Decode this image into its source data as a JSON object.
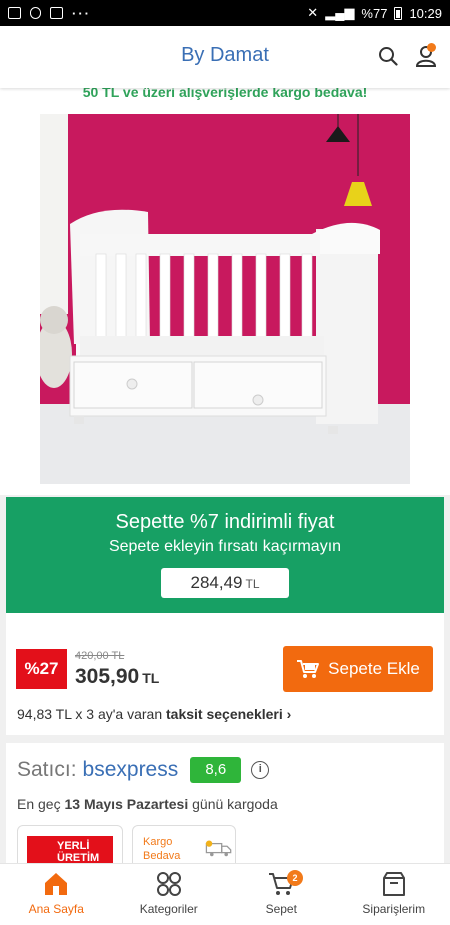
{
  "status_bar": {
    "battery": "%77",
    "time": "10:29"
  },
  "header": {
    "brand": "By Damat"
  },
  "shipping_banner": "50 TL ve üzeri alışverişlerde kargo bedava!",
  "discount": {
    "title": "Sepette %7 indirimli fiyat",
    "subtitle": "Sepete ekleyin fırsatı kaçırmayın",
    "price": "284,49",
    "currency": "TL"
  },
  "price": {
    "discount_badge": "%27",
    "old_price": "420,00 TL",
    "new_price": "305,90",
    "currency": "TL",
    "add_to_cart": "Sepete Ekle",
    "installment_prefix": "94,83 TL x 3 ay'a varan ",
    "installment_link": "taksit seçenekleri",
    "installment_chevron": "›"
  },
  "seller": {
    "label": "Satıcı:",
    "name": "bsexpress",
    "score": "8,6",
    "info": "i",
    "ship_prefix": "En geç ",
    "ship_date": "13 Mayıs Pazartesi",
    "ship_suffix": " günü kargoda",
    "badge_local_line1": "YERLİ",
    "badge_local_line2": "ÜRETİM",
    "badge_cargo_line1": "Kargo",
    "badge_cargo_line2": "Bedava"
  },
  "nav": {
    "items": [
      {
        "label": "Ana Sayfa",
        "icon": "home-icon",
        "active": true
      },
      {
        "label": "Kategoriler",
        "icon": "categories-icon"
      },
      {
        "label": "Sepet",
        "icon": "cart-icon",
        "badge": "2"
      },
      {
        "label": "Siparişlerim",
        "icon": "orders-icon"
      }
    ]
  },
  "colors": {
    "brand_blue": "#3a6fb5",
    "green": "#17a064",
    "orange": "#f26a0f",
    "red": "#e3101a",
    "score_green": "#2fb53a"
  }
}
